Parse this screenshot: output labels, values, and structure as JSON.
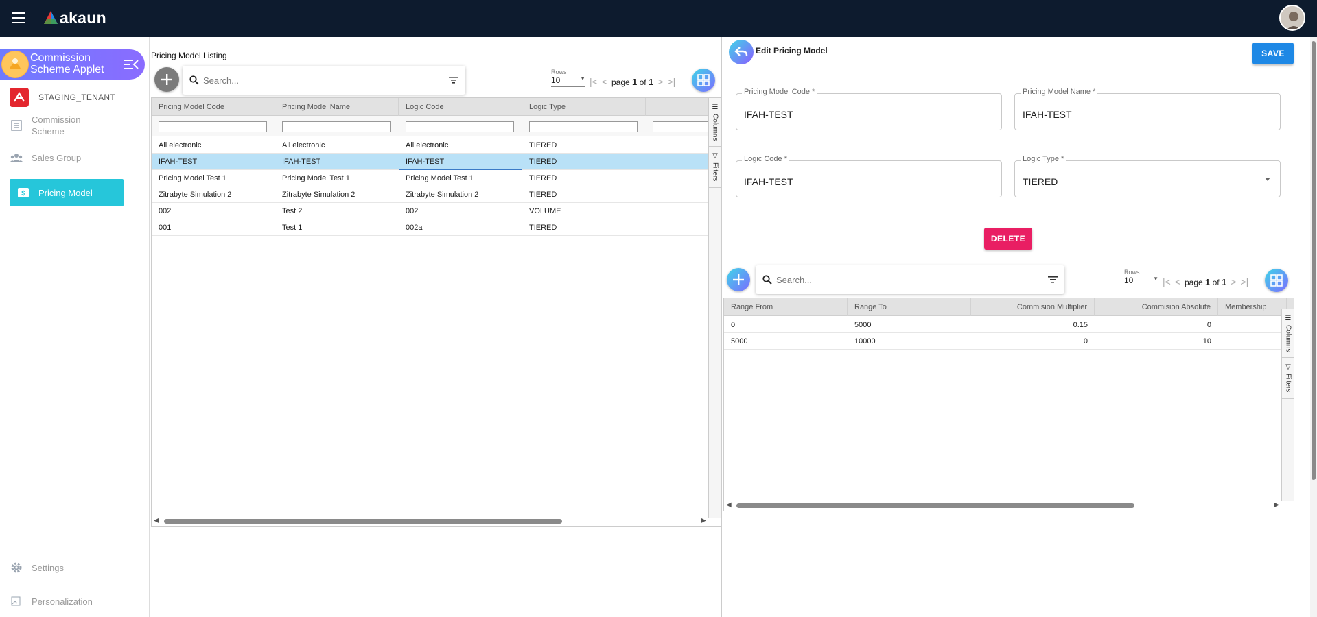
{
  "app": {
    "brand": "akaun"
  },
  "sidebar": {
    "applet_title": "Commission Scheme Applet",
    "tenant": "STAGING_TENANT",
    "items": [
      {
        "label": "Commission Scheme"
      },
      {
        "label": "Sales Group"
      },
      {
        "label": "Pricing Model"
      }
    ],
    "settings_label": "Settings",
    "personalization_label": "Personalization"
  },
  "listing": {
    "title": "Pricing Model Listing",
    "search_placeholder": "Search...",
    "rows_label": "Rows",
    "rows_value": "10",
    "page_word": "page",
    "page_current": "1",
    "of_word": "of",
    "page_total": "1",
    "columns": [
      "Pricing Model Code",
      "Pricing Model Name",
      "Logic Code",
      "Logic Type"
    ],
    "rows": [
      [
        "All electronic",
        "All electronic",
        "All electronic",
        "TIERED"
      ],
      [
        "IFAH-TEST",
        "IFAH-TEST",
        "IFAH-TEST",
        "TIERED"
      ],
      [
        "Pricing Model Test 1",
        "Pricing Model Test 1",
        "Pricing Model Test 1",
        "TIERED"
      ],
      [
        "Zitrabyte Simulation 2",
        "Zitrabyte Simulation 2",
        "Zitrabyte Simulation 2",
        "TIERED"
      ],
      [
        "002",
        "Test 2",
        "002",
        "VOLUME"
      ],
      [
        "001",
        "Test 1",
        "002a",
        "TIERED"
      ]
    ],
    "side_tabs": [
      "Columns",
      "Filters"
    ]
  },
  "editor": {
    "title": "Edit Pricing Model",
    "save_label": "SAVE",
    "delete_label": "DELETE",
    "fields": {
      "code_label": "Pricing Model Code *",
      "code_value": "IFAH-TEST",
      "name_label": "Pricing Model Name *",
      "name_value": "IFAH-TEST",
      "logic_code_label": "Logic Code *",
      "logic_code_value": "IFAH-TEST",
      "logic_type_label": "Logic Type *",
      "logic_type_value": "TIERED"
    },
    "tiers": {
      "search_placeholder": "Search...",
      "rows_label": "Rows",
      "rows_value": "10",
      "page_word": "page",
      "page_current": "1",
      "of_word": "of",
      "page_total": "1",
      "columns": [
        "Range From",
        "Range To",
        "Commision Multiplier",
        "Commision Absolute",
        "Membership"
      ],
      "rows": [
        [
          "0",
          "5000",
          "0.15",
          "0"
        ],
        [
          "5000",
          "10000",
          "0",
          "10"
        ]
      ],
      "side_tabs": [
        "Columns",
        "Filters"
      ]
    }
  }
}
